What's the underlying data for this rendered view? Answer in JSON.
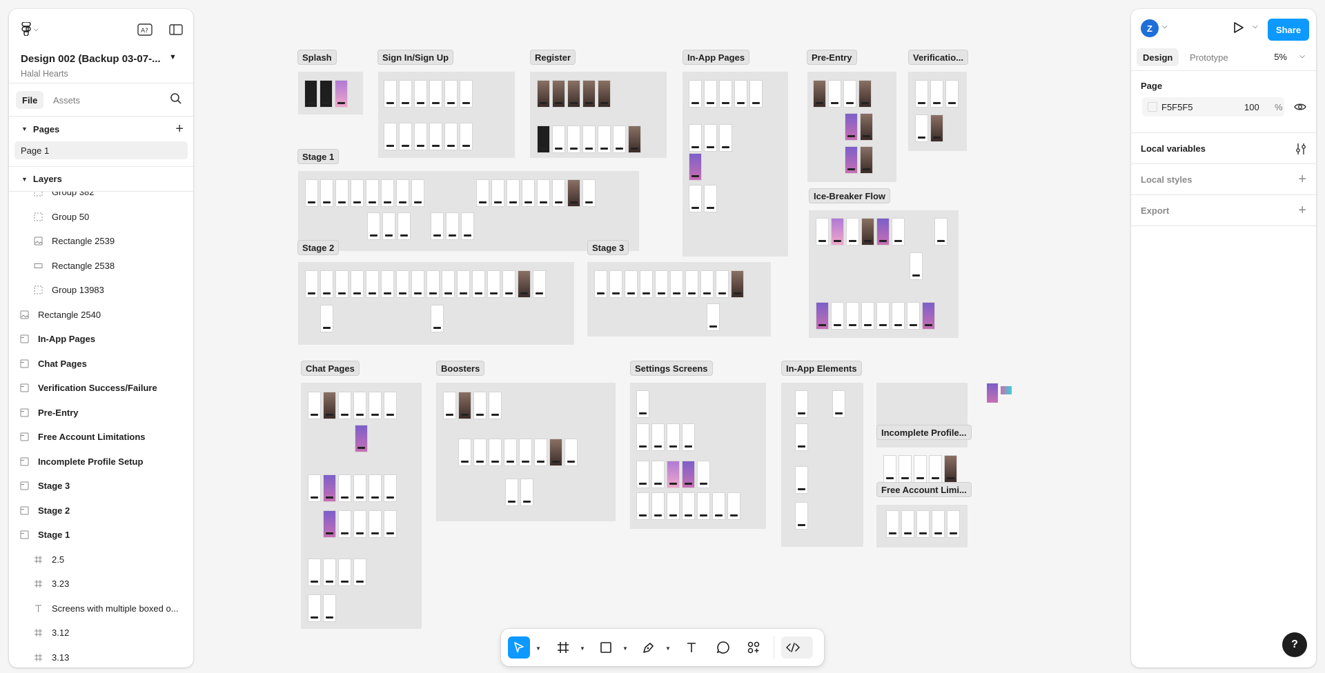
{
  "file": {
    "title": "Design 002 (Backup 03-07-...",
    "project": "Halal Hearts"
  },
  "left_tabs": {
    "file": "File",
    "assets": "Assets"
  },
  "pages_section": {
    "label": "Pages",
    "items": [
      "Page 1"
    ]
  },
  "layers_section": {
    "label": "Layers",
    "items": [
      {
        "name": "Group 382",
        "icon": "group-icon",
        "indent": 2,
        "bold": false
      },
      {
        "name": "Group 50",
        "icon": "group-icon",
        "indent": 2,
        "bold": false
      },
      {
        "name": "Rectangle 2539",
        "icon": "image-icon",
        "indent": 2,
        "bold": false
      },
      {
        "name": "Rectangle 2538",
        "icon": "rectangle-icon",
        "indent": 2,
        "bold": false
      },
      {
        "name": "Group 13983",
        "icon": "group-icon",
        "indent": 2,
        "bold": false
      },
      {
        "name": "Rectangle 2540",
        "icon": "image-icon",
        "indent": 1,
        "bold": false
      },
      {
        "name": "In-App Pages",
        "icon": "section-icon",
        "indent": 1,
        "bold": true
      },
      {
        "name": "Chat Pages",
        "icon": "section-icon",
        "indent": 1,
        "bold": true
      },
      {
        "name": "Verification Success/Failure",
        "icon": "section-icon",
        "indent": 1,
        "bold": true
      },
      {
        "name": "Pre-Entry",
        "icon": "section-icon",
        "indent": 1,
        "bold": true
      },
      {
        "name": "Free Account Limitations",
        "icon": "section-icon",
        "indent": 1,
        "bold": true
      },
      {
        "name": "Incomplete Profile Setup",
        "icon": "section-icon",
        "indent": 1,
        "bold": true
      },
      {
        "name": "Stage 3",
        "icon": "section-icon",
        "indent": 1,
        "bold": true
      },
      {
        "name": "Stage 2",
        "icon": "section-icon",
        "indent": 1,
        "bold": true
      },
      {
        "name": "Stage 1",
        "icon": "section-icon",
        "indent": 1,
        "bold": true
      },
      {
        "name": "2.5",
        "icon": "frame-icon",
        "indent": 2,
        "bold": false
      },
      {
        "name": "3.23",
        "icon": "frame-icon",
        "indent": 2,
        "bold": false
      },
      {
        "name": "Screens with multiple boxed o...",
        "icon": "text-icon",
        "indent": 2,
        "bold": false
      },
      {
        "name": "3.12",
        "icon": "frame-icon",
        "indent": 2,
        "bold": false
      },
      {
        "name": "3.13",
        "icon": "frame-icon",
        "indent": 2,
        "bold": false
      }
    ]
  },
  "right": {
    "avatar_initial": "Z",
    "share_label": "Share",
    "tabs": {
      "design": "Design",
      "prototype": "Prototype"
    },
    "zoom": "5%",
    "page_label": "Page",
    "page_color_hex": "F5F5F5",
    "page_opacity": "100",
    "page_opacity_unit": "%",
    "local_variables": "Local variables",
    "local_styles": "Local styles",
    "export": "Export"
  },
  "canvas": {
    "sections": [
      {
        "label": "Splash"
      },
      {
        "label": "Sign In/Sign Up"
      },
      {
        "label": "Register"
      },
      {
        "label": "In-App Pages"
      },
      {
        "label": "Pre-Entry"
      },
      {
        "label": "Verificatio..."
      },
      {
        "label": "Stage 1"
      },
      {
        "label": "Ice-Breaker Flow"
      },
      {
        "label": "Stage 2"
      },
      {
        "label": "Stage 3"
      },
      {
        "label": "Chat Pages"
      },
      {
        "label": "Boosters"
      },
      {
        "label": "Settings Screens"
      },
      {
        "label": "In-App Elements"
      },
      {
        "label": "Incomplete Profile..."
      },
      {
        "label": "Free Account Limi..."
      }
    ]
  },
  "help_label": "?",
  "colors": {
    "accent": "#0d99ff",
    "canvas": "#F5F5F5",
    "section": "#e4e4e4",
    "avatar": "#1e6fd9"
  }
}
